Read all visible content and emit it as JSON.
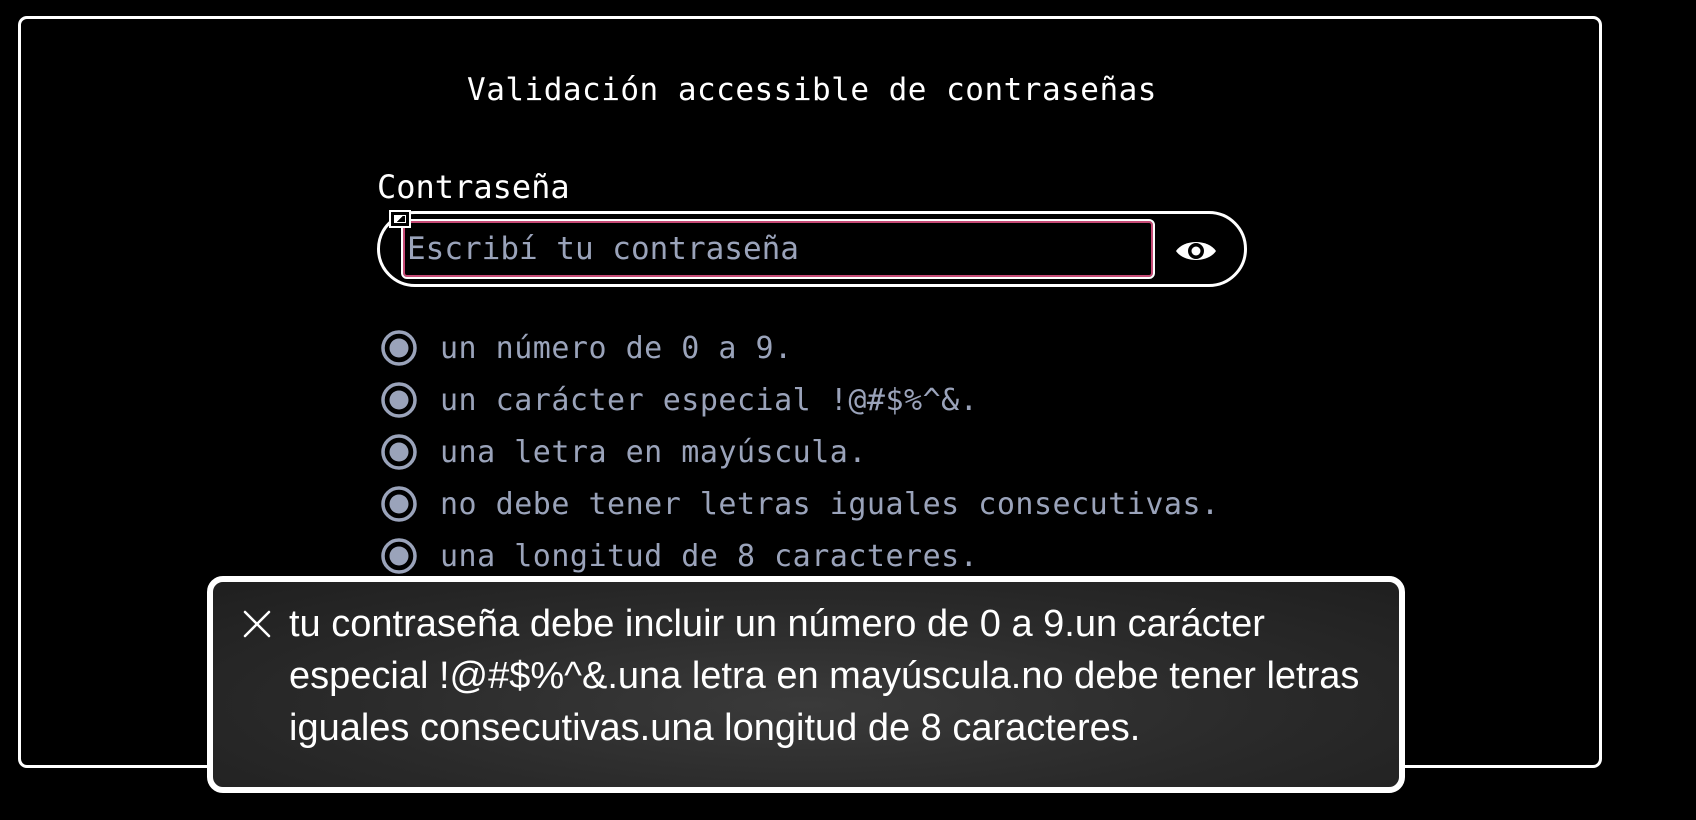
{
  "app": {
    "title": "Validación accessible de contraseñas"
  },
  "password": {
    "label": "Contraseña",
    "placeholder": "Escribí tu contraseña",
    "value": "",
    "toggle_icon": "eye-icon"
  },
  "requirements": [
    {
      "text": "un número de 0 a 9."
    },
    {
      "text": "un carácter especial !@#$%^&."
    },
    {
      "text": "una letra en mayúscula."
    },
    {
      "text": "no debe tener letras iguales consecutivas."
    },
    {
      "text": "una longitud de 8 caracteres."
    }
  ],
  "toast": {
    "message": "tu contraseña debe incluir un número de 0 a 9.un carácter especial !@#$%^&.una letra en mayúscula.no debe tener letras iguales consecutivas.una longitud de 8 caracteres.",
    "close_icon": "close-icon"
  },
  "colors": {
    "background": "#000000",
    "foreground": "#ffffff",
    "muted": "#9aa3ba",
    "input_focus": "#c64b76",
    "toast_bg": "#2a2a2a"
  }
}
